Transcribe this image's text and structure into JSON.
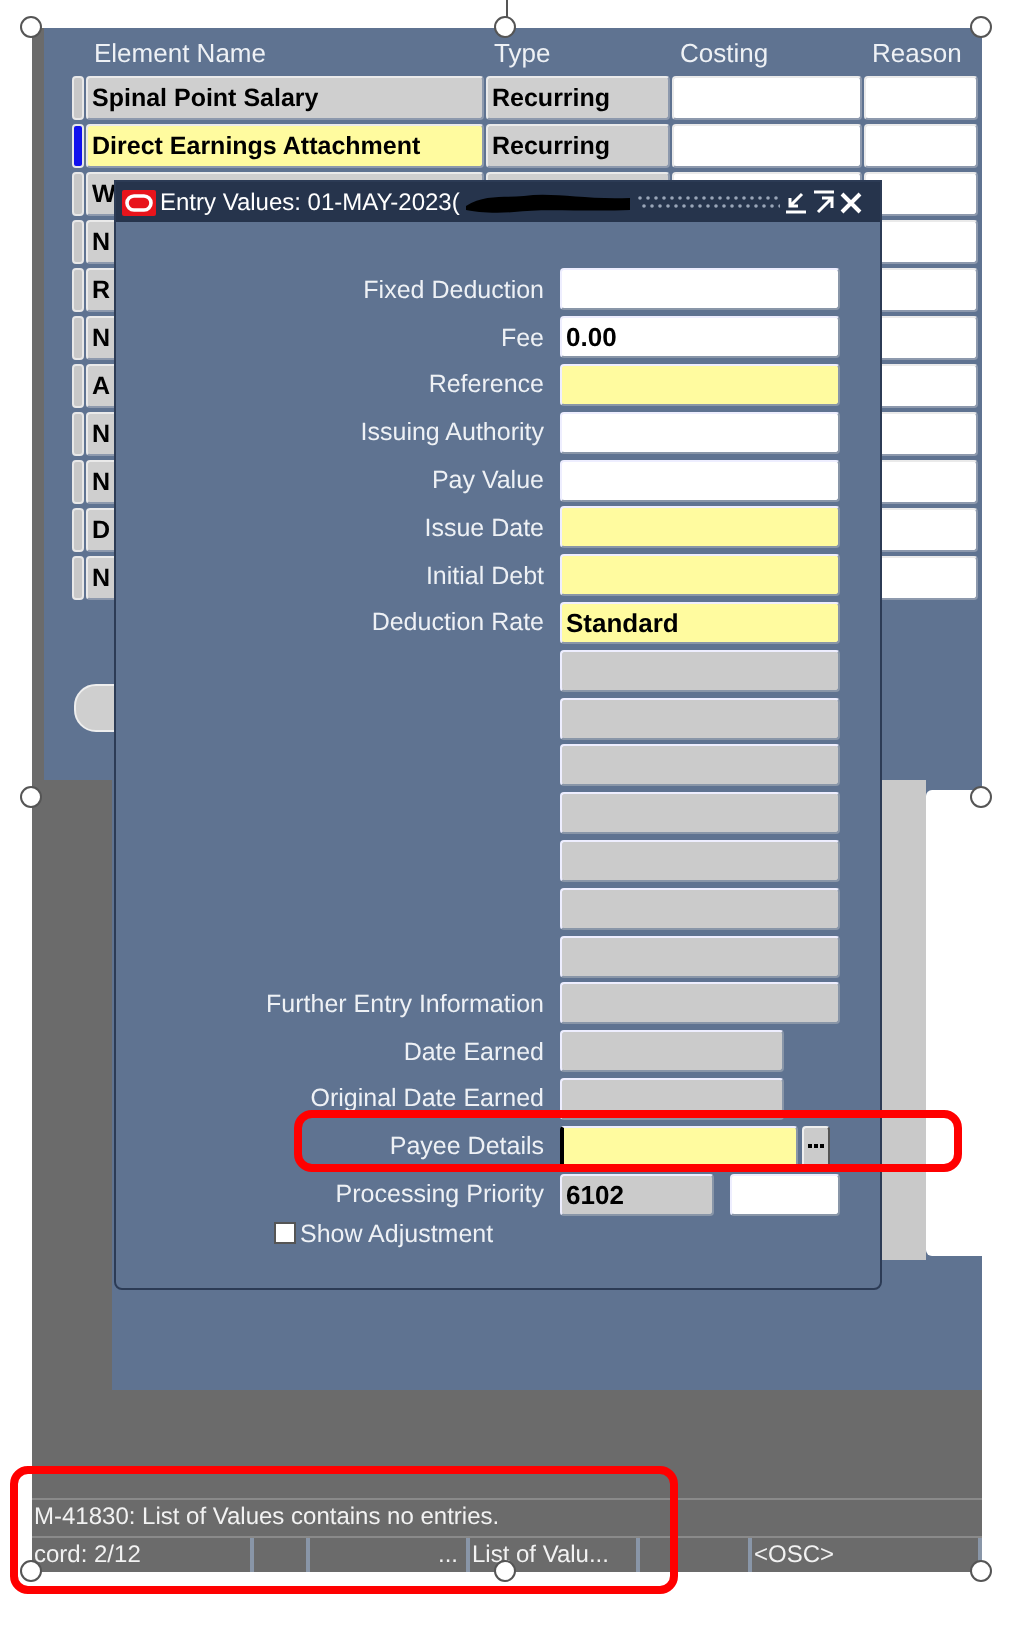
{
  "grid": {
    "columns": [
      "Element Name",
      "Type",
      "Costing",
      "Reason"
    ],
    "rows": [
      {
        "name": "Spinal Point Salary",
        "type": "Recurring",
        "selected": false
      },
      {
        "name": "Direct Earnings Attachment",
        "type": "Recurring",
        "selected": true
      },
      {
        "name": "W",
        "selected": false
      },
      {
        "name": "N",
        "selected": false
      },
      {
        "name": "R",
        "selected": false
      },
      {
        "name": "N",
        "selected": false
      },
      {
        "name": "A",
        "selected": false
      },
      {
        "name": "N",
        "selected": false
      },
      {
        "name": "N",
        "selected": false
      },
      {
        "name": "D",
        "selected": false
      },
      {
        "name": "N",
        "selected": false
      }
    ]
  },
  "dialog": {
    "title": "Entry Values: 01-MAY-2023(",
    "fields": [
      {
        "label": "Fixed Deduction",
        "kind": "text",
        "required": false,
        "disabled": false,
        "focused": false
      },
      {
        "label": "Fee",
        "kind": "text",
        "required": false,
        "disabled": false,
        "value": "0.00",
        "focused": false
      },
      {
        "label": "Reference",
        "kind": "text",
        "required": true,
        "disabled": false,
        "focused": false
      },
      {
        "label": "Issuing Authority",
        "kind": "text",
        "required": false,
        "disabled": false,
        "focused": false
      },
      {
        "label": "Pay Value",
        "kind": "text",
        "required": false,
        "disabled": false,
        "focused": false
      },
      {
        "label": "Issue Date",
        "kind": "text",
        "required": true,
        "disabled": false,
        "focused": false
      },
      {
        "label": "Initial Debt",
        "kind": "text",
        "required": true,
        "disabled": false,
        "focused": false
      },
      {
        "label": "Deduction Rate",
        "kind": "text",
        "required": true,
        "disabled": false,
        "value": "Standard",
        "focused": false
      },
      {
        "kind": "text",
        "disabled": true,
        "focused": false
      },
      {
        "kind": "text",
        "disabled": true,
        "focused": false
      },
      {
        "kind": "text",
        "disabled": true,
        "focused": false
      },
      {
        "kind": "text",
        "disabled": true,
        "focused": false
      },
      {
        "kind": "text",
        "disabled": true,
        "focused": false
      },
      {
        "kind": "text",
        "disabled": true,
        "focused": false
      },
      {
        "kind": "text",
        "disabled": true,
        "focused": false
      },
      {
        "label": "Further Entry Information",
        "kind": "text",
        "disabled": true,
        "focused": false
      },
      {
        "label": "Date Earned",
        "kind": "date",
        "disabled": true,
        "focused": false
      },
      {
        "label": "Original Date Earned",
        "kind": "date",
        "disabled": true,
        "focused": false
      },
      {
        "label": "Payee Details",
        "kind": "lov",
        "required": true,
        "disabled": false,
        "focused": true
      },
      {
        "label": "Processing Priority",
        "kind": "priority",
        "disabled": true,
        "value": "6102",
        "focused": false
      }
    ],
    "checkbox": {
      "label": "Show Adjustment",
      "checked": false
    }
  },
  "message": "M-41830: List of Values contains no entries.",
  "status_bar": [
    {
      "kind": "text",
      "text": "cord: 2/12"
    },
    {
      "kind": "blank"
    },
    {
      "kind": "trailing",
      "text": "..."
    },
    {
      "kind": "text",
      "text": "List of Valu..."
    },
    {
      "kind": "blank"
    },
    {
      "kind": "text",
      "text": "<OSC>"
    }
  ]
}
